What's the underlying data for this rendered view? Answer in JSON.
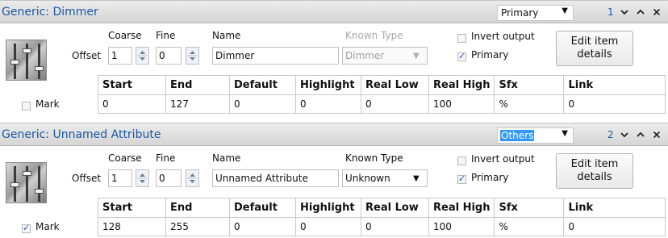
{
  "panels": [
    {
      "title": "Generic: Dimmer",
      "selector": {
        "value": "Primary",
        "highlighted": false
      },
      "index": "1",
      "labels": {
        "coarse": "Coarse",
        "fine": "Fine",
        "name": "Name",
        "known_type": "Known Type",
        "offset": "Offset"
      },
      "known_type_enabled": false,
      "coarse": "1",
      "fine": "0",
      "name": "Dimmer",
      "known_type": "Dimmer",
      "invert_output": {
        "label": "Invert output",
        "checked": false
      },
      "primary": {
        "label": "Primary",
        "checked": true
      },
      "edit_button": {
        "line1": "Edit item",
        "line2": "details"
      },
      "mark": {
        "label": "Mark",
        "checked": false
      },
      "columns": [
        "Start",
        "End",
        "Default",
        "Highlight",
        "Real Low",
        "Real High",
        "Sfx",
        "Link"
      ],
      "row": [
        "0",
        "127",
        "0",
        "0",
        "0",
        "100",
        "%",
        "0"
      ]
    },
    {
      "title": "Generic: Unnamed Attribute",
      "selector": {
        "value": "Others",
        "highlighted": true
      },
      "index": "2",
      "labels": {
        "coarse": "Coarse",
        "fine": "Fine",
        "name": "Name",
        "known_type": "Known Type",
        "offset": "Offset"
      },
      "known_type_enabled": true,
      "coarse": "1",
      "fine": "0",
      "name": "Unnamed Attribute",
      "known_type": "Unknown",
      "invert_output": {
        "label": "Invert output",
        "checked": false
      },
      "primary": {
        "label": "Primary",
        "checked": true
      },
      "edit_button": {
        "line1": "Edit item",
        "line2": "details"
      },
      "mark": {
        "label": "Mark",
        "checked": true
      },
      "columns": [
        "Start",
        "End",
        "Default",
        "Highlight",
        "Real Low",
        "Real High",
        "Sfx",
        "Link"
      ],
      "row": [
        "128",
        "255",
        "0",
        "0",
        "0",
        "100",
        "%",
        "0"
      ]
    }
  ],
  "icons": {
    "header_buttons": [
      "chevron-down-icon",
      "chevron-up-icon",
      "close-icon"
    ],
    "spinner": "spinner-arrows-icon",
    "thumbnail": "fader-thumbnail-icon"
  },
  "colors": {
    "title_text": "#1a57a8",
    "selection_highlight": "#3399ff",
    "check_mark": "#2a56b8"
  }
}
